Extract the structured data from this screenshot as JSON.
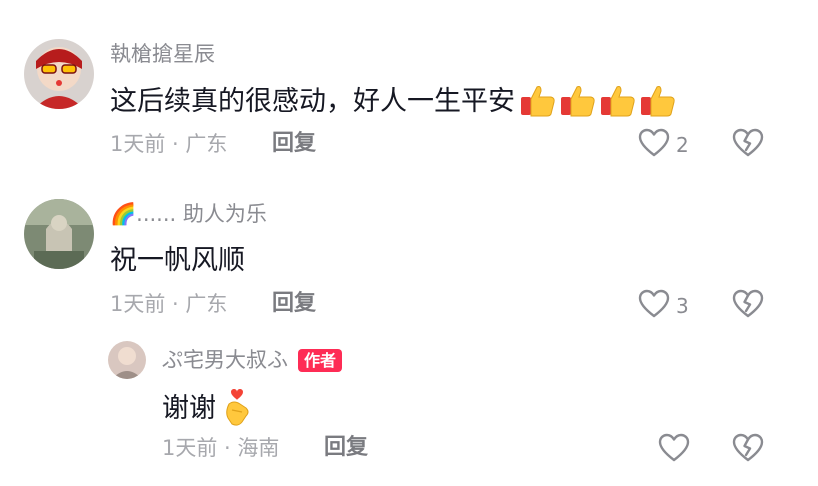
{
  "comments": [
    {
      "username": "執槍搶星辰",
      "text": "这后续真的很感动，好人一生平安",
      "emoji": "thumbs-up-icon ×4",
      "meta": "1天前 · 广东",
      "reply_label": "回复",
      "likes": "2"
    },
    {
      "username": "🌈...... 助人为乐",
      "text": "祝一帆风顺",
      "meta": "1天前 · 广东",
      "reply_label": "回复",
      "likes": "3",
      "replies": [
        {
          "username": "ぷ宅男大叔ふ",
          "badge": "作者",
          "text": "谢谢",
          "emoji": "finger-heart-icon",
          "meta": "1天前 · 海南",
          "reply_label": "回复"
        }
      ]
    }
  ],
  "colors": {
    "username": "#8a8b91",
    "text": "#161823",
    "meta": "#a7a8ad",
    "badge": "#fe2c55"
  }
}
